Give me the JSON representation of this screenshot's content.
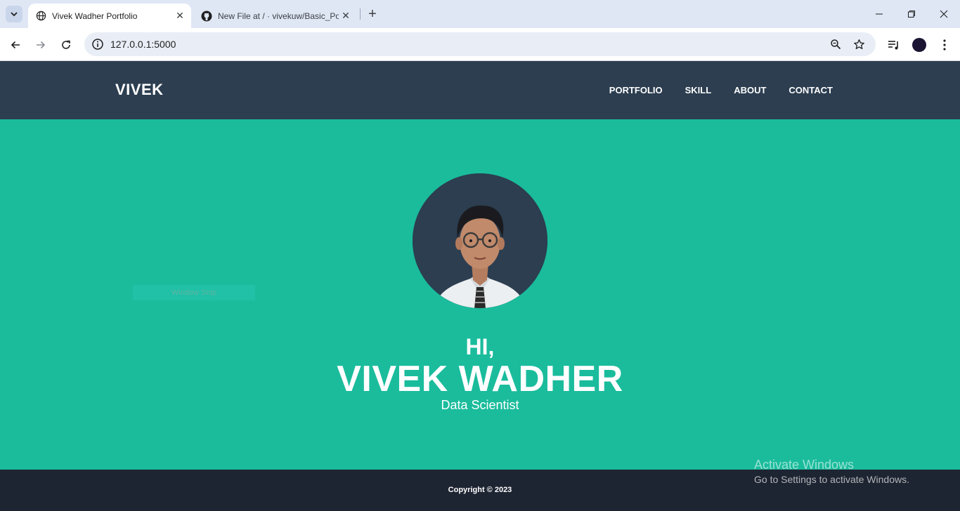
{
  "browser": {
    "tabs": [
      {
        "title": "Vivek Wadher Portfolio",
        "icon": "globe-icon",
        "active": true
      },
      {
        "title": "New File at / · vivekuw/Basic_Po",
        "icon": "github-icon",
        "active": false
      }
    ],
    "url": "127.0.0.1:5000"
  },
  "site": {
    "brand": "VIVEK",
    "nav": [
      "PORTFOLIO",
      "SKILL",
      "ABOUT",
      "CONTACT"
    ],
    "hero": {
      "greeting": "HI,",
      "name": "VIVEK WADHER",
      "role": "Data Scientist"
    },
    "footer": "Copyright © 2023"
  },
  "overlay": {
    "snip_label": "Window Snip",
    "activate_title": "Activate Windows",
    "activate_sub": "Go to Settings to activate Windows."
  },
  "colors": {
    "nav_bg": "#2c3e50",
    "hero_bg": "#1abc9c",
    "footer_bg": "#1e2532"
  }
}
